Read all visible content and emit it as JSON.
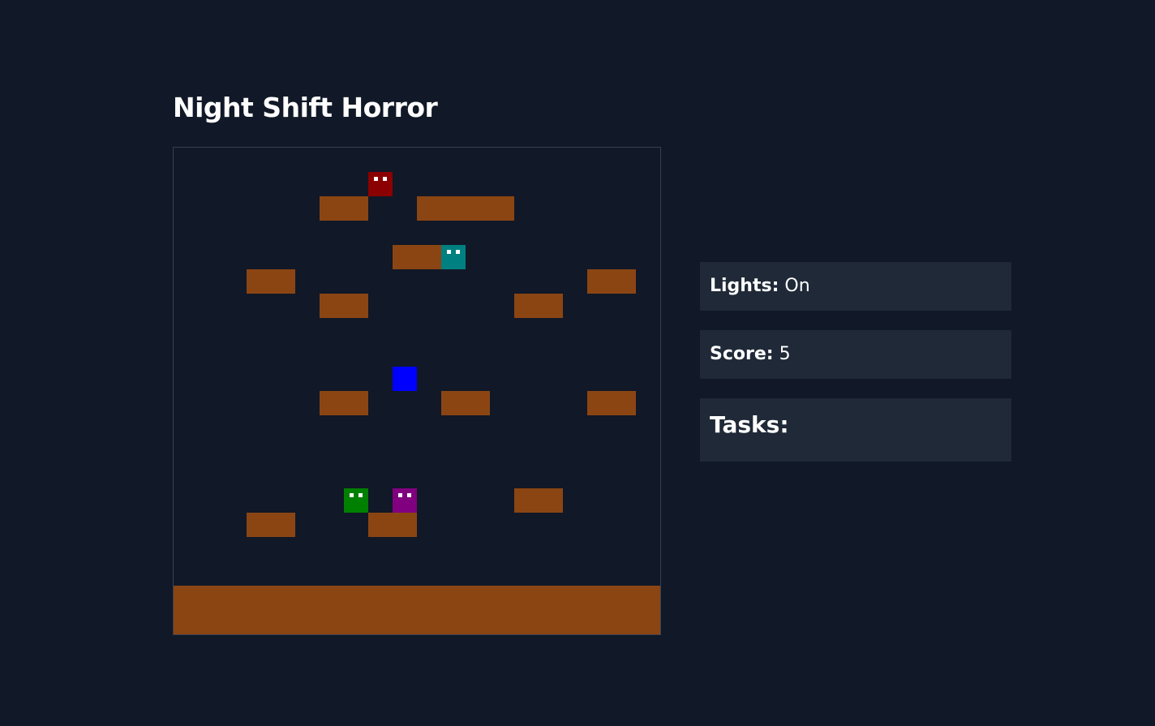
{
  "title": "Night Shift Horror",
  "status": {
    "lights_label": "Lights:",
    "lights_value": "On",
    "score_label": "Score:",
    "score_value": "5",
    "tasks_heading": "Tasks:"
  },
  "colors": {
    "background": "#111827",
    "panel": "#1f2937",
    "block": "#8b4513",
    "player": "#0000ff",
    "ghost_red": "#8b0000",
    "ghost_teal": "#008080",
    "ghost_green": "#008000",
    "ghost_purple": "#800080",
    "ghost_eye": "#ffffff"
  },
  "ghosts": [
    {
      "name": "ghost-red",
      "color": "#8b0000"
    },
    {
      "name": "ghost-teal",
      "color": "#008080"
    },
    {
      "name": "ghost-green",
      "color": "#008000"
    },
    {
      "name": "ghost-purple",
      "color": "#800080"
    }
  ]
}
